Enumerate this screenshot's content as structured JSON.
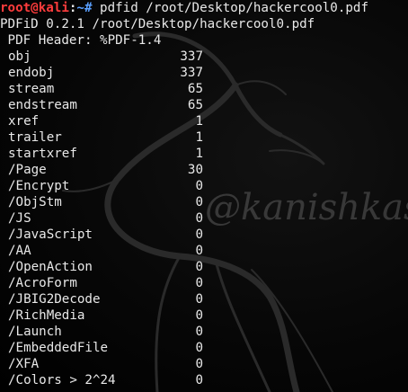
{
  "terminal": {
    "prompt": {
      "user_host": "root@kali",
      "separator": ":",
      "path_symbol": "~#",
      "command": " pdfid /root/Desktop/hackercool0.pdf"
    },
    "version_line": "PDFiD 0.2.1 /root/Desktop/hackercool0.pdf",
    "header_line": " PDF Header: %PDF-1.4",
    "rows": [
      {
        "key": "obj",
        "value": "337"
      },
      {
        "key": "endobj",
        "value": "337"
      },
      {
        "key": "stream",
        "value": "65"
      },
      {
        "key": "endstream",
        "value": "65"
      },
      {
        "key": "xref",
        "value": "1"
      },
      {
        "key": "trailer",
        "value": "1"
      },
      {
        "key": "startxref",
        "value": "1"
      },
      {
        "key": "/Page",
        "value": "30"
      },
      {
        "key": "/Encrypt",
        "value": "0"
      },
      {
        "key": "/ObjStm",
        "value": "0"
      },
      {
        "key": "/JS",
        "value": "0"
      },
      {
        "key": "/JavaScript",
        "value": "0"
      },
      {
        "key": "/AA",
        "value": "0"
      },
      {
        "key": "/OpenAction",
        "value": "0"
      },
      {
        "key": "/AcroForm",
        "value": "0"
      },
      {
        "key": "/JBIG2Decode",
        "value": "0"
      },
      {
        "key": "/RichMedia",
        "value": "0"
      },
      {
        "key": "/Launch",
        "value": "0"
      },
      {
        "key": "/EmbeddedFile",
        "value": "0"
      },
      {
        "key": "/XFA",
        "value": "0"
      },
      {
        "key": "/Colors > 2^24",
        "value": "0"
      }
    ]
  },
  "watermark": "@kanishkashowto",
  "colors": {
    "background": "#000000",
    "text": "#e8e8e8",
    "prompt_user": "#ff3c3c",
    "prompt_path": "#5aa0ff"
  },
  "background_icon": "kali-dragon-logo"
}
